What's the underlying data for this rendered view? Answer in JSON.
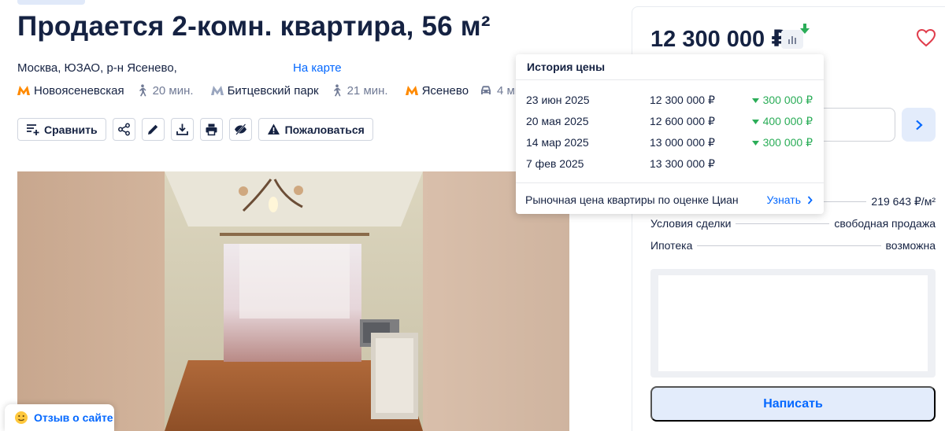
{
  "listing": {
    "title": "Продается 2-комн. квартира, 56 м²",
    "address": "Москва, ЮЗАО, р-н Ясенево,",
    "map_link": "На карте",
    "metro": [
      {
        "name": "Новоясеневская",
        "travel": "20 мин.",
        "mode": "walk-icon"
      },
      {
        "name": "Битцевский парк",
        "travel": "21 мин.",
        "mode": "walk-icon"
      },
      {
        "name": "Ясенево",
        "travel": "4 мин.",
        "mode": "car-icon"
      }
    ],
    "metro_color": "#ff8a00"
  },
  "actions": {
    "compare_label": "Сравнить",
    "report_label": "Пожаловаться"
  },
  "feedback": {
    "label": "Отзыв о сайте"
  },
  "sidebar": {
    "price": "12 300 000 ₽",
    "info": [
      {
        "key": "",
        "value": "219 643 ₽/м²"
      },
      {
        "key": "Условия сделки",
        "value": "свободная продажа"
      },
      {
        "key": "Ипотека",
        "value": "возможна"
      }
    ],
    "write_button": "Написать"
  },
  "price_history": {
    "title": "История цены",
    "rows": [
      {
        "date": "23 июн 2025",
        "price": "12 300 000 ₽",
        "change": "300 000 ₽"
      },
      {
        "date": "20 мая 2025",
        "price": "12 600 000 ₽",
        "change": "400 000 ₽"
      },
      {
        "date": "14 мар 2025",
        "price": "13 000 000 ₽",
        "change": "300 000 ₽"
      },
      {
        "date": "7 фев 2025",
        "price": "13 300 000 ₽",
        "change": ""
      }
    ],
    "market_label": "Рыночная цена квартиры по оценке Циан",
    "market_link": "Узнать"
  },
  "colors": {
    "accent": "#0468ff",
    "decrease": "#2bad58",
    "text": "#152242",
    "muted": "#707a95"
  }
}
